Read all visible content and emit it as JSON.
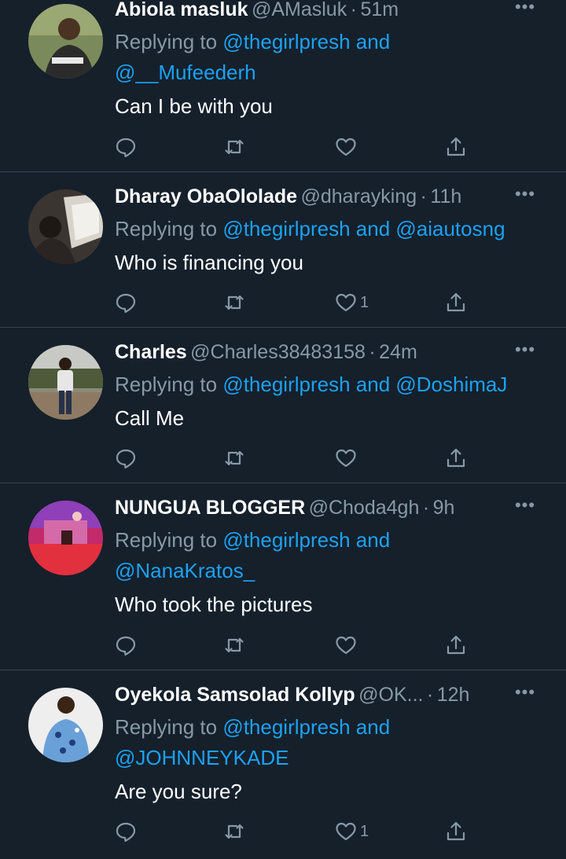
{
  "tweets": [
    {
      "name": "Abiola masluk",
      "handle": "@AMasluk",
      "time": "51m",
      "replying_prefix": "Replying to ",
      "replying_line1": "@thegirlpresh and",
      "replying_line2": "@__Mufeederh",
      "text": "Can I be with you",
      "like_count": ""
    },
    {
      "name": "Dharay ObaOlolade",
      "handle": "@dharayking",
      "time": "11h",
      "replying_prefix": "Replying to ",
      "replying_line1": "@thegirlpresh and @aiautosng",
      "replying_line2": "",
      "text": "Who is financing you",
      "like_count": "1"
    },
    {
      "name": "Charles",
      "handle": "@Charles38483158",
      "time": "24m",
      "replying_prefix": "Replying to ",
      "replying_line1": "@thegirlpresh and @DoshimaJ",
      "replying_line2": "",
      "text": "Call Me",
      "like_count": ""
    },
    {
      "name": "NUNGUA BLOGGER",
      "handle": "@Choda4gh",
      "time": "9h",
      "replying_prefix": "Replying to ",
      "replying_line1": "@thegirlpresh and",
      "replying_line2": "@NanaKratos_",
      "text": "Who took the pictures",
      "like_count": ""
    },
    {
      "name": "Oyekola Samsolad Kollyp",
      "handle": "@OK...",
      "time": "12h",
      "replying_prefix": "Replying to ",
      "replying_line1": "@thegirlpresh and",
      "replying_line2": "@JOHNNEYKADE",
      "text": "Are you sure?",
      "like_count": "1"
    }
  ],
  "separator": "·",
  "more_glyph": "•••",
  "icons": {
    "reply": "reply-icon",
    "retweet": "retweet-icon",
    "like": "heart-icon",
    "share": "share-icon",
    "more": "more-icon"
  },
  "colors": {
    "background": "#15202b",
    "divider": "#38444d",
    "secondary_text": "#8899a6",
    "link": "#1da1f2",
    "primary_text": "#ffffff"
  }
}
